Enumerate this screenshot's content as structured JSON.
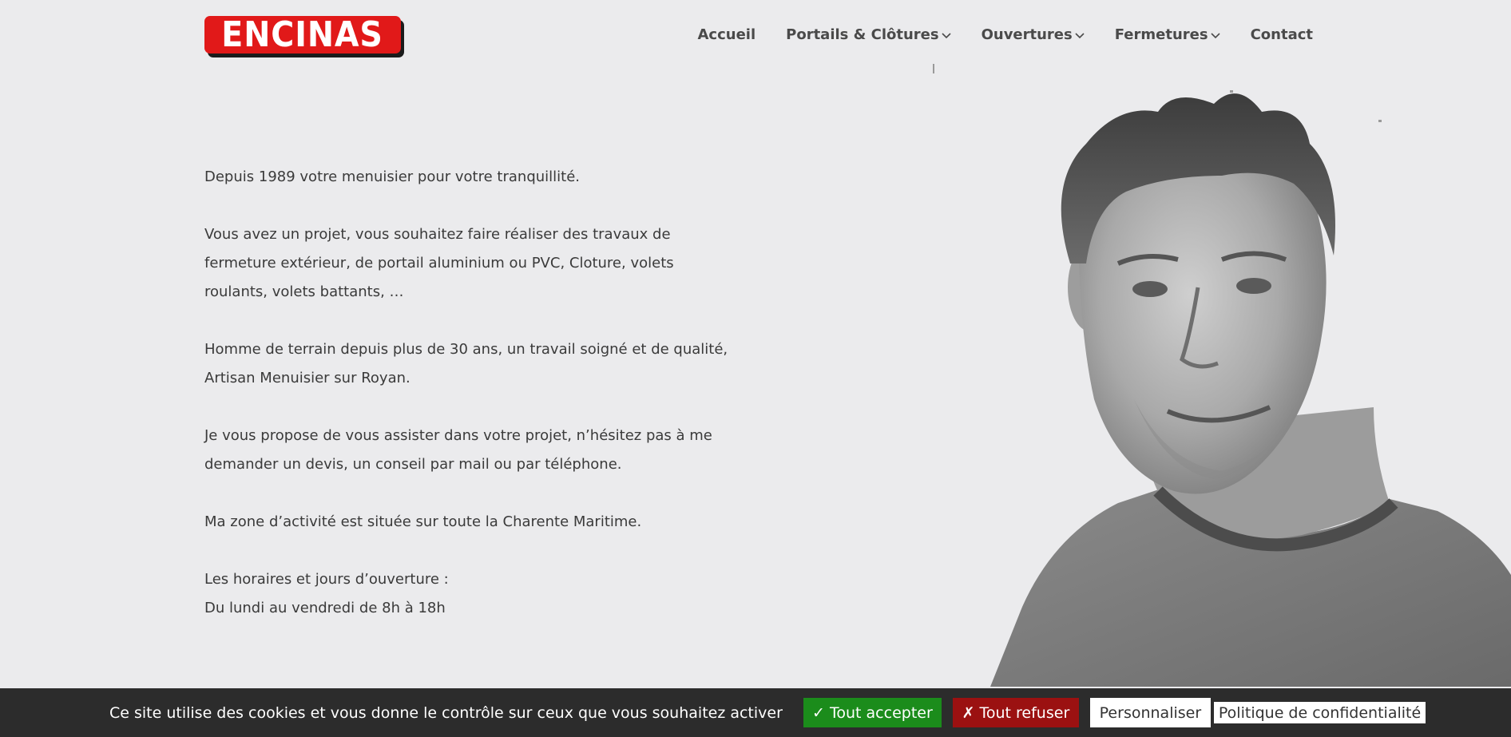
{
  "brand": {
    "logo_text": "ENCINAS",
    "red": "#e11919"
  },
  "nav": {
    "items": [
      {
        "label": "Accueil",
        "dropdown": false
      },
      {
        "label": "Portails & Clôtures",
        "dropdown": true
      },
      {
        "label": "Ouvertures",
        "dropdown": true
      },
      {
        "label": "Fermetures",
        "dropdown": true
      },
      {
        "label": "Contact",
        "dropdown": false
      }
    ]
  },
  "content": {
    "paragraphs": [
      "Depuis 1989 votre menuisier pour votre tranquillité.",
      "Vous avez un projet, vous souhaitez faire réaliser des travaux de fermeture extérieur, de portail aluminium ou PVC, Cloture, volets roulants, volets battants, …",
      "Homme de terrain depuis plus de 30 ans, un travail soigné et de qualité, Artisan Menuisier sur Royan.",
      "Je vous propose de vous assister dans votre projet, n’hésitez pas à me demander un devis, un conseil par mail ou par téléphone.",
      "Ma zone d’activité est située sur toute la Charente Maritime."
    ],
    "hours_title": "Les horaires et jours d’ouverture :",
    "hours_value": "Du lundi au vendredi de 8h à 18h"
  },
  "cookie_banner": {
    "text": "Ce site utilise des cookies et vous donne le contrôle sur ceux que vous souhaitez activer",
    "accept_label": "✓ Tout accepter",
    "refuse_label": "✗ Tout refuser",
    "customize_label": "Personnaliser",
    "policy_label": "Politique de confidentialité",
    "accept_color": "#1b8c1b",
    "refuse_color": "#9b1111"
  }
}
